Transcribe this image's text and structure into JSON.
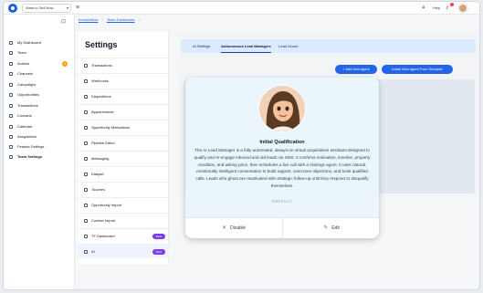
{
  "topbar": {
    "workspace": "Want to Sell Now",
    "help_label": "Help"
  },
  "sidebar": {
    "items": [
      {
        "label": "My Dashboard"
      },
      {
        "label": "Team"
      },
      {
        "label": "Actions",
        "badge": "9"
      },
      {
        "label": "Channels"
      },
      {
        "label": "Campaigns"
      },
      {
        "label": "Opportunities"
      },
      {
        "label": "Transactions"
      },
      {
        "label": "Contacts"
      },
      {
        "label": "Calendar"
      },
      {
        "label": "Integrations"
      },
      {
        "label": "Feature Settings"
      },
      {
        "label": "Team Settings"
      }
    ]
  },
  "breadcrumb": {
    "first": "Investorflow",
    "sep": "›",
    "second": "Team Dashboard",
    "sep2": "›"
  },
  "settings": {
    "title": "Settings",
    "items": [
      {
        "label": "Transactions"
      },
      {
        "label": "Webhooks"
      },
      {
        "label": "Dispositions"
      },
      {
        "label": "Appointments"
      },
      {
        "label": "Opportunity Motivations"
      },
      {
        "label": "Pipeline Editor"
      },
      {
        "label": "Messaging"
      },
      {
        "label": "Dialpad"
      },
      {
        "label": "Touches"
      },
      {
        "label": "Opportunity Import"
      },
      {
        "label": "Contact Import"
      },
      {
        "label": "TF Dashboard",
        "beta": "Beta"
      },
      {
        "label": "AI",
        "beta": "Beta"
      }
    ]
  },
  "main": {
    "tabs": [
      {
        "label": "AI Settings"
      },
      {
        "label": "Autonomous Lead Managers"
      },
      {
        "label": "Lead Scorer"
      }
    ],
    "add_button": "+ Add New Agent",
    "install_button": "Install New Agent From Template"
  },
  "card": {
    "title": "Initial Qualification",
    "description": "The AI Lead Manager is a fully automated, always-on virtual acquisitions assistant designed to qualify and re-engage inbound and old leads via SMS. It confirms motivation, timeline, property condition, and asking price, then schedules a live call with a closings agent. It uses natural, emotionally intelligent conversation to build rapport, overcome objections, and book qualified calls. Leads who ghost are reactivated with strategic follow-up until they respond or disqualify themselves.",
    "tag": "DEFAULT",
    "disable_label": "Disable",
    "edit_label": "Edit"
  },
  "colors": {
    "accent": "#2563eb",
    "beta_badge": "#7c3aed",
    "actions_badge": "#f59e0b",
    "card_top": "#eaf6fb"
  }
}
